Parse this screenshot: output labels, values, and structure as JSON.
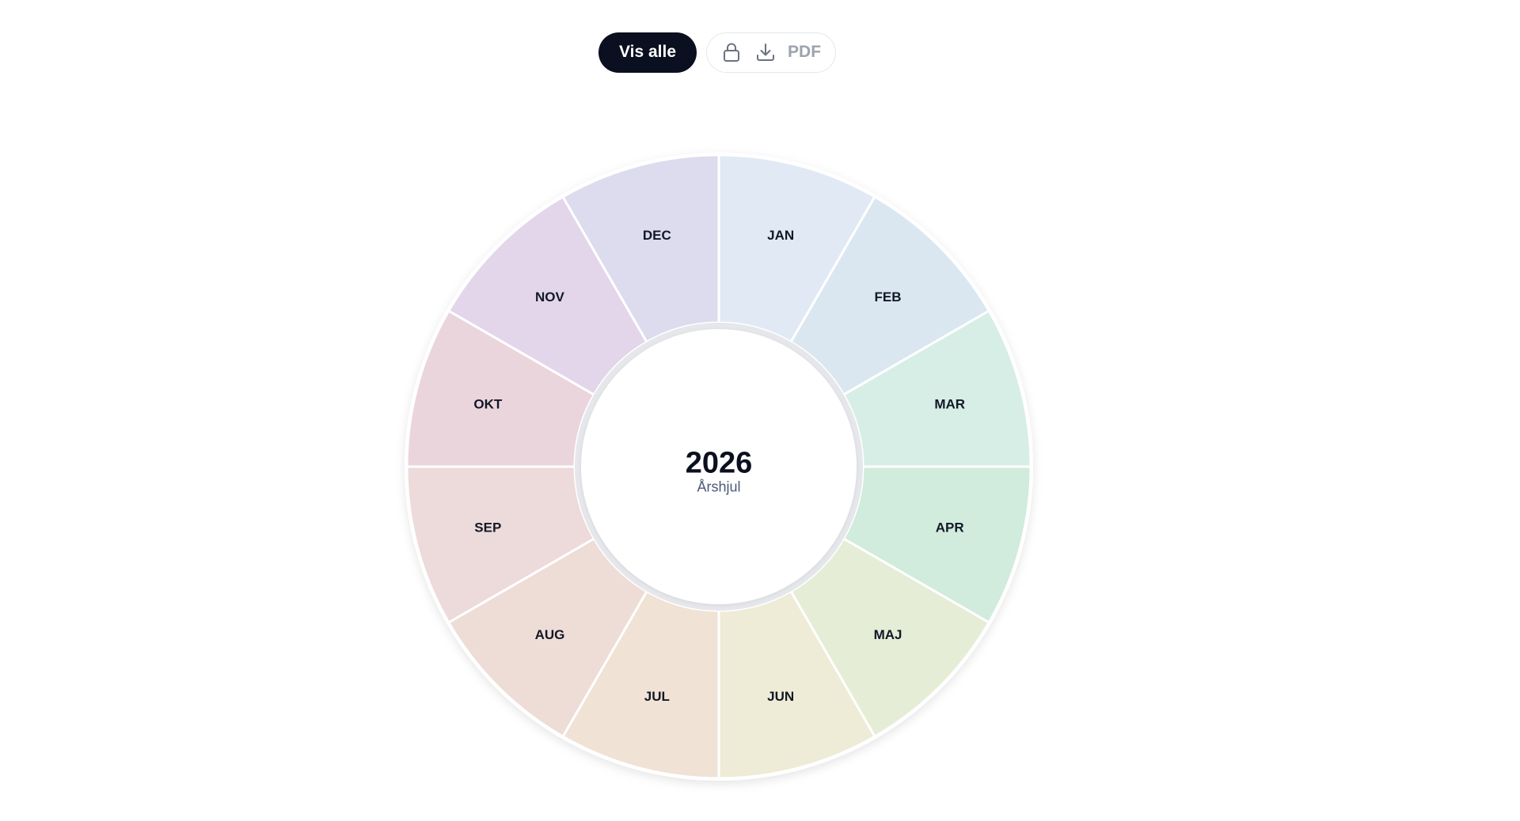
{
  "toolbar": {
    "show_all_label": "Vis alle",
    "lock_icon": "lock-icon",
    "download_icon": "download-icon",
    "pdf_label": "PDF"
  },
  "wheel": {
    "year": "2026",
    "subtitle": "Årshjul",
    "months": [
      {
        "label": "JAN",
        "color": "#e1e9f4"
      },
      {
        "label": "FEB",
        "color": "#dae7f1"
      },
      {
        "label": "MAR",
        "color": "#d7eee6"
      },
      {
        "label": "APR",
        "color": "#d1ebdc"
      },
      {
        "label": "MAJ",
        "color": "#e5edd7"
      },
      {
        "label": "JUN",
        "color": "#eeebd6"
      },
      {
        "label": "JUL",
        "color": "#f0e2d5"
      },
      {
        "label": "AUG",
        "color": "#eedcd6"
      },
      {
        "label": "SEP",
        "color": "#eddada"
      },
      {
        "label": "OKT",
        "color": "#ebd5dd"
      },
      {
        "label": "NOV",
        "color": "#e3d6ea"
      },
      {
        "label": "DEC",
        "color": "#dcdcee"
      }
    ]
  }
}
